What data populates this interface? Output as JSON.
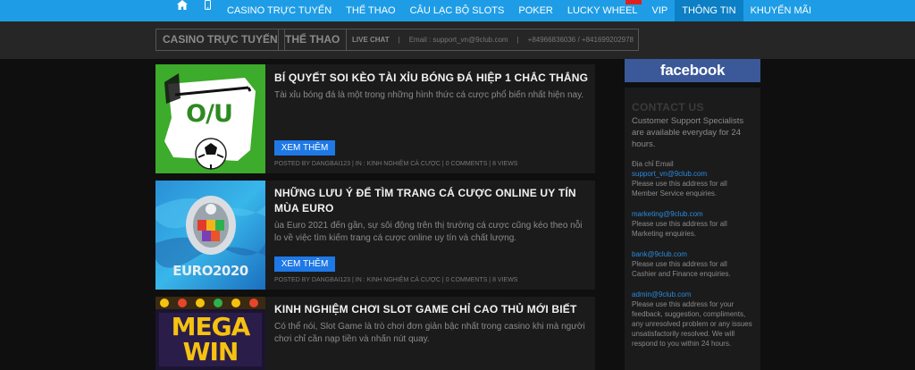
{
  "nav": {
    "items": [
      "CASINO TRỰC TUYẾN",
      "THỂ THAO",
      "CÂU LẠC BỘ SLOTS",
      "POKER",
      "LUCKY WHEEL",
      "VIP",
      "THÔNG TIN",
      "KHUYẾN MÃI"
    ],
    "active_index": 6
  },
  "subbar": {
    "casino_btn": "CASINO TRỰC TUYẾN",
    "sports_btn": "THỂ THAO",
    "live_chat": "LIVE CHAT",
    "email": "Email : support_vn@9club.com",
    "phones": "+84966836036 / +841699202978"
  },
  "posts": [
    {
      "title": "BÍ QUYẾT SOI KÈO TÀI XỈU BÓNG ĐÁ HIỆP 1 CHẮC THẮNG",
      "excerpt": "Tài xỉu bóng đá là một trong những hình thức cá cược phổ biến nhất hiện nay.",
      "read_more": "XEM THÊM",
      "meta": "POSTED BY DANGBAI123 | IN : KINH NGHIỆM CÁ CƯỢC | 0 COMMENTS | 8 VIEWS",
      "thumb_text": "O/U"
    },
    {
      "title": "NHỮNG LƯU Ý ĐỂ TÌM TRANG CÁ CƯỢC ONLINE UY TÍN MÙA EURO",
      "excerpt": "ùa Euro 2021 đến gần, sự sôi động trên thị trường cá cược cũng kéo theo nỗi lo về việc tìm kiếm trang cá cược online uy tín và chất lượng.",
      "read_more": "XEM THÊM",
      "meta": "POSTED BY DANGBAI123 | IN : KINH NGHIỆM CÁ CƯỢC | 0 COMMENTS | 8 VIEWS",
      "thumb_text": "EURO2020"
    },
    {
      "title": "KINH NGHIỆM CHƠI SLOT GAME CHỈ CAO THỦ MỚI BIẾT",
      "excerpt": "Có thể nói, Slot Game là trò chơi đơn giản bậc nhất trong casino khi mà người chơi chỉ cần nạp tiền và nhấn nút quay.",
      "thumb_text": "MEGA WIN"
    }
  ],
  "sidebar": {
    "facebook": "facebook",
    "contact_title": "CONTACT US",
    "intro": "Customer Support Specialists are available everyday for 24 hours.",
    "email_label": "Địa chỉ Email",
    "entries": [
      {
        "email": "support_vn@9club.com",
        "desc": "Please use this address for all Member Service enquiries."
      },
      {
        "email": "marketing@9club.com",
        "desc": "Please use this address for all Marketing enquiries."
      },
      {
        "email": "bank@9club.com",
        "desc": "Please use this address for all Cashier and Finance enquiries."
      },
      {
        "email": "admin@9club.com",
        "desc": "Please use this address for your feedback, suggestion, compliments, any unresolved problem or any issues unsatisfactorily resolved. We will respond to you within 24 hours."
      }
    ]
  },
  "colors": {
    "nav": "#1e9de6",
    "nav_active": "#0c7fc5",
    "button": "#1e78e6",
    "facebook": "#3b5998",
    "link": "#2a8ae0"
  }
}
